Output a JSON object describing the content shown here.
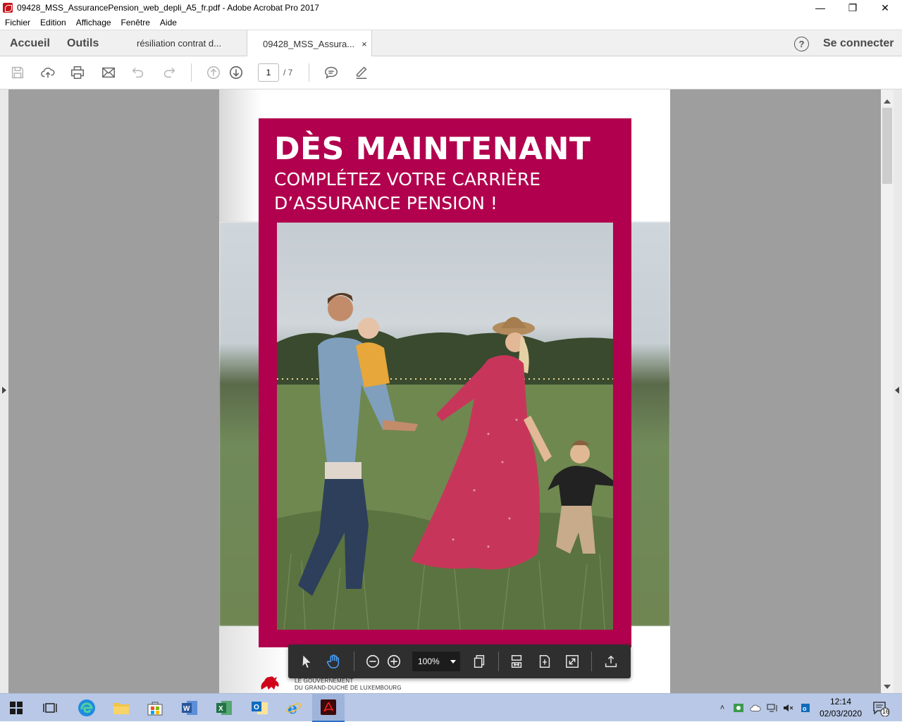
{
  "window": {
    "title": "09428_MSS_AssurancePension_web_depli_A5_fr.pdf - Adobe Acrobat Pro 2017",
    "controls": [
      "minimize",
      "restore",
      "close"
    ]
  },
  "menu": [
    "Fichier",
    "Edition",
    "Affichage",
    "Fenêtre",
    "Aide"
  ],
  "tabs": {
    "home": "Accueil",
    "tools": "Outils",
    "documents": [
      {
        "label": "résiliation contrat d...",
        "active": false
      },
      {
        "label": "09428_MSS_Assura...",
        "active": true,
        "close": "×"
      }
    ],
    "help": "?",
    "signin": "Se connecter"
  },
  "toolbar": {
    "icons": [
      "save-icon",
      "upload-icon",
      "print-icon",
      "email-icon",
      "undo-icon",
      "redo-icon",
      "prev-page-icon",
      "next-page-icon",
      "comment-icon",
      "sign-icon"
    ],
    "page_current": "1",
    "page_total": "/ 7"
  },
  "document": {
    "headline": "DÈS MAINTENANT",
    "subtitle_line1": "COMPLÉTEZ VOTRE CARRIÈRE",
    "subtitle_line2": "D’ASSURANCE PENSION !",
    "govt_line1": "LE GOUVERNEMENT",
    "govt_line2": "DU GRAND-DUCHÉ DE LUXEMBOURG",
    "accent_color": "#b1004d"
  },
  "floating_toolbar": {
    "icons": [
      "select-arrow-icon",
      "hand-tool-icon",
      "zoom-out-icon",
      "zoom-in-icon",
      "page-display-icon",
      "fit-width-icon",
      "fit-page-icon",
      "full-screen-icon",
      "share-icon"
    ],
    "zoom": "100%"
  },
  "taskbar": {
    "apps": [
      "start-icon",
      "task-view-icon",
      "edge-icon",
      "file-explorer-icon",
      "store-icon",
      "word-icon",
      "excel-icon",
      "outlook-icon",
      "ie-icon",
      "acrobat-icon"
    ],
    "time": "12:14",
    "date": "02/03/2020",
    "notifications": "16"
  }
}
